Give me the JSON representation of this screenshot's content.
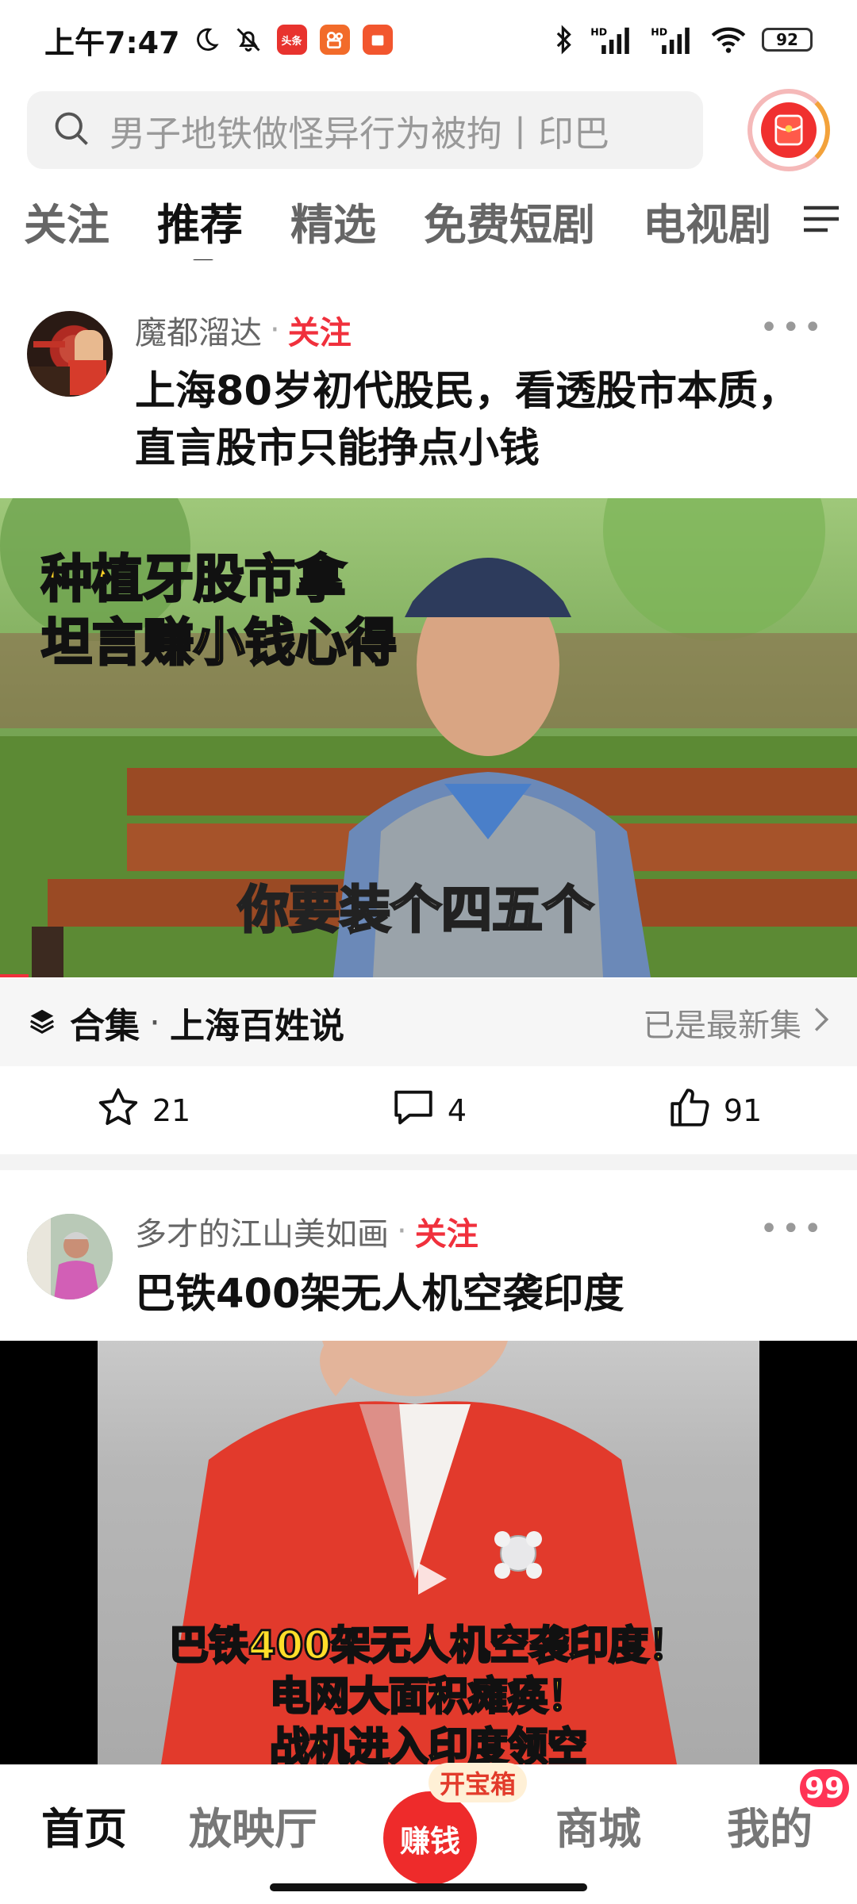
{
  "status_bar": {
    "time": "上午7:47",
    "app_badge_1": "头条",
    "battery": "92"
  },
  "search": {
    "placeholder": "男子地铁做怪异行为被拘丨印巴"
  },
  "tabs": [
    {
      "label": "关注"
    },
    {
      "label": "推荐"
    },
    {
      "label": "精选"
    },
    {
      "label": "免费短剧"
    },
    {
      "label": "电视剧"
    }
  ],
  "posts": [
    {
      "author": "魔都溜达",
      "separator": "·",
      "follow_label": "关注",
      "more": "•••",
      "title_line1": "上海80岁初代股民，看透股市本质，",
      "title_line2": "直言股市只能挣点小钱",
      "video_overlay_line1": "种植牙股市拿",
      "video_overlay_line2": "坦言赚小钱心得",
      "video_subtitle": "你要装个四五个",
      "collection_prefix": "合集",
      "collection_separator": "·",
      "collection_name": "上海百姓说",
      "collection_latest": "已是最新集",
      "stats": {
        "favorites": "21",
        "comments": "4",
        "likes": "91"
      }
    },
    {
      "author": "多才的江山美如画",
      "separator": "·",
      "follow_label": "关注",
      "more": "•••",
      "title": "巴铁400架无人机空袭印度",
      "video_line1": "巴铁400架无人机空袭印度！",
      "video_line2": "电网大面积瘫痪！",
      "video_line3": "战机进入印度领空"
    }
  ],
  "bottom_nav": {
    "home": "首页",
    "theater": "放映厅",
    "earn": "赚钱",
    "earn_tag": "开宝箱",
    "mall": "商城",
    "me": "我的",
    "me_badge": "99"
  },
  "colors": {
    "accent_red": "#f0303c",
    "overlay_yellow": "#ffd226"
  }
}
